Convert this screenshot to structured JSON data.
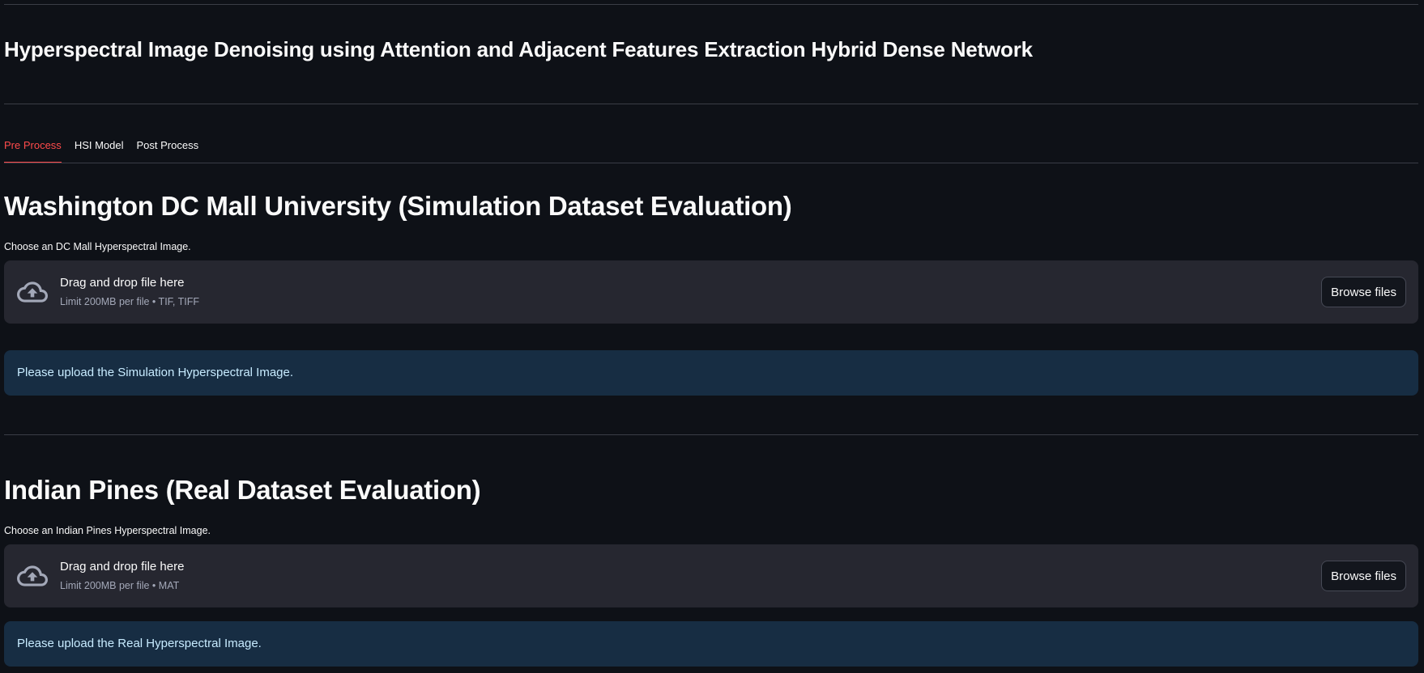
{
  "app": {
    "title": "Hyperspectral Image Denoising using Attention and Adjacent Features Extraction Hybrid Dense Network"
  },
  "tabs": [
    {
      "label": "Pre Process",
      "active": true
    },
    {
      "label": "HSI Model",
      "active": false
    },
    {
      "label": "Post Process",
      "active": false
    }
  ],
  "sections": [
    {
      "title": "Washington DC Mall University (Simulation Dataset Evaluation)",
      "uploader_label": "Choose an DC Mall Hyperspectral Image.",
      "dropzone_text": "Drag and drop file here",
      "dropzone_limit": "Limit 200MB per file • TIF, TIFF",
      "browse_label": "Browse files",
      "info": "Please upload the Simulation Hyperspectral Image."
    },
    {
      "title": "Indian Pines (Real Dataset Evaluation)",
      "uploader_label": "Choose an Indian Pines Hyperspectral Image.",
      "dropzone_text": "Drag and drop file here",
      "dropzone_limit": "Limit 200MB per file • MAT",
      "browse_label": "Browse files",
      "info": "Please upload the Real Hyperspectral Image."
    }
  ],
  "icons": {
    "upload": "cloud-upload-icon"
  },
  "colors": {
    "background": "#0e1117",
    "accent": "#ff4b4b",
    "dropzone": "#262730",
    "info_bg": "#172d43",
    "info_text": "#c7ebff"
  }
}
